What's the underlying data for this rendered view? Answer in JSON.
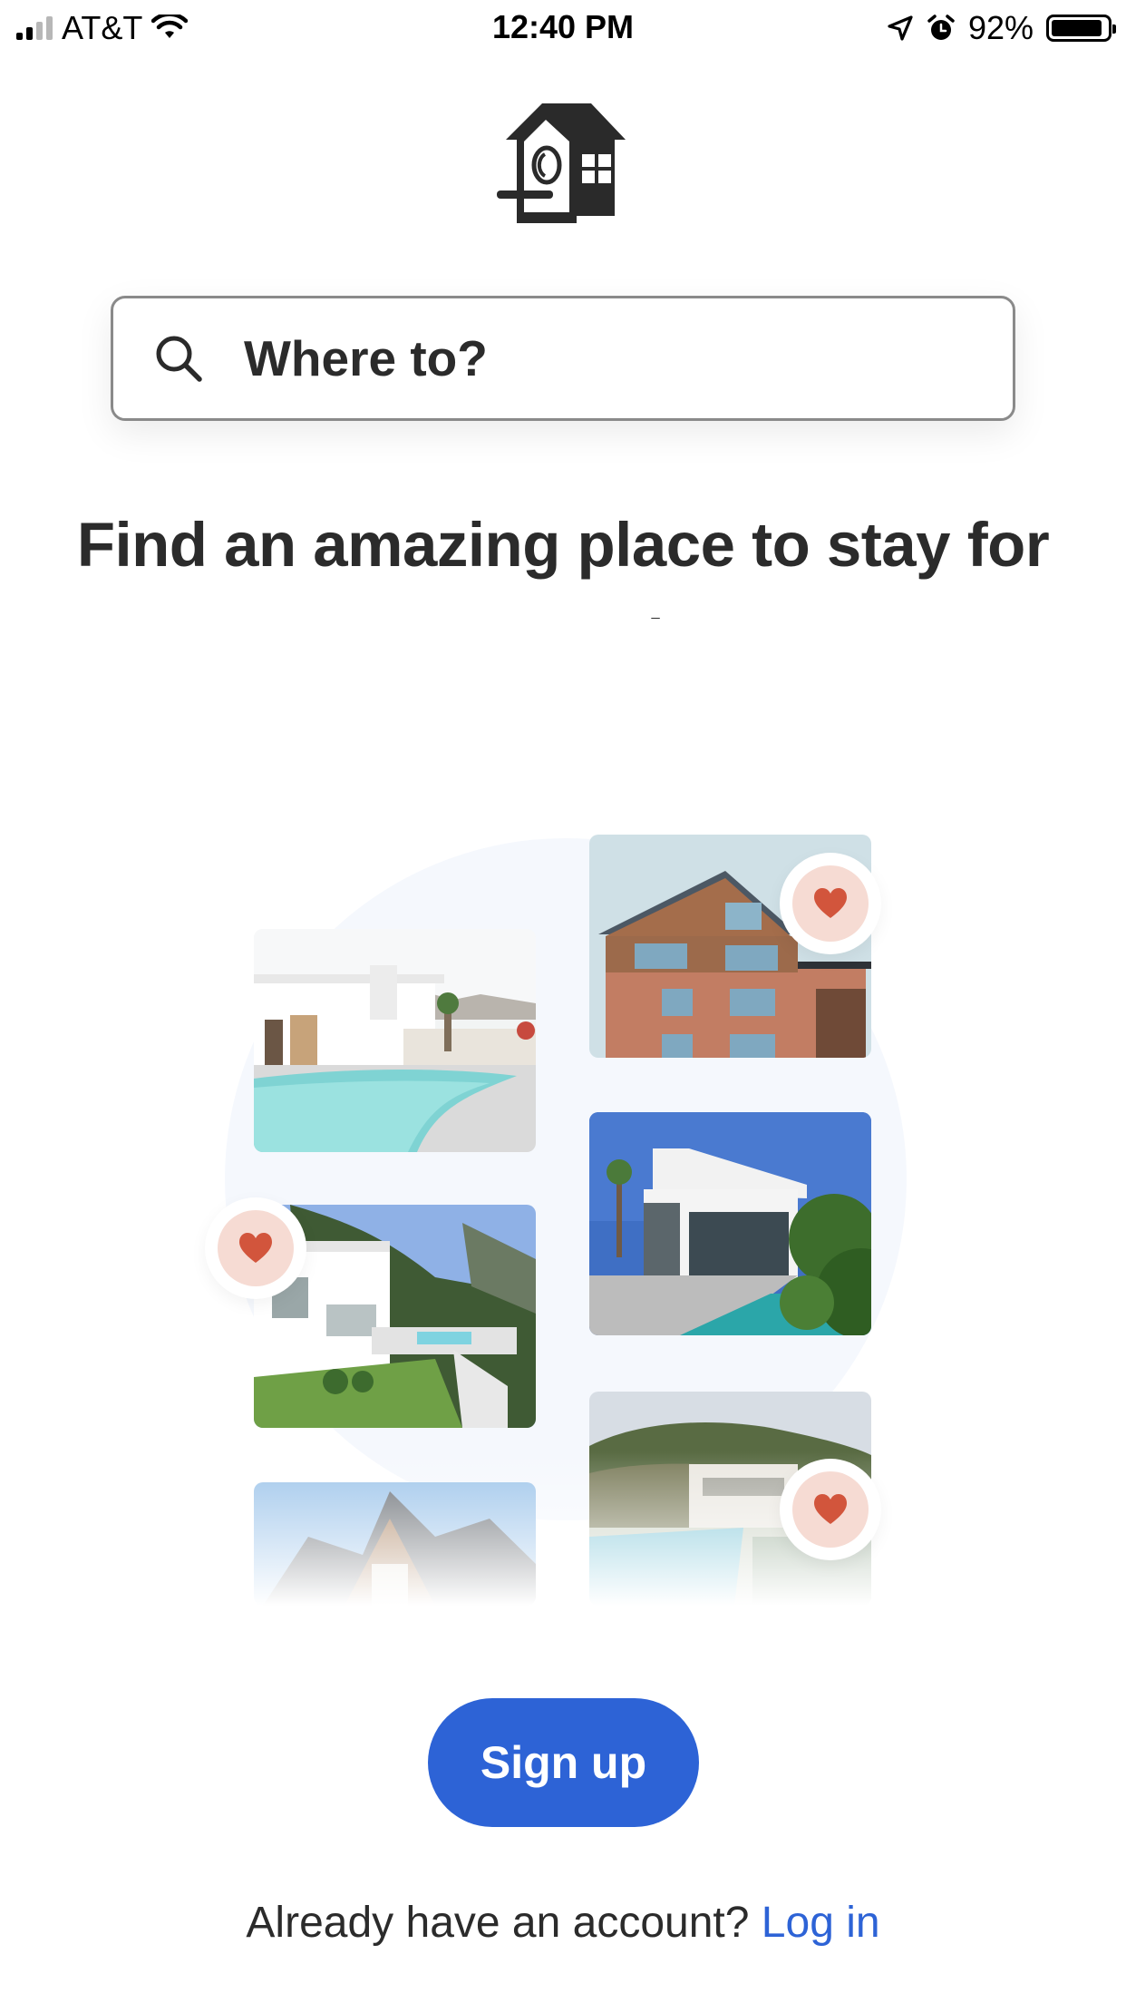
{
  "status_bar": {
    "carrier": "AT&T",
    "time": "12:40 PM",
    "battery_percent": "92%",
    "icons": [
      "signal-icon",
      "wifi-icon",
      "location-arrow-icon",
      "alarm-icon",
      "battery-icon"
    ]
  },
  "logo": {
    "icon": "house-logo-icon"
  },
  "search": {
    "placeholder": "Where to?",
    "icon": "search-icon"
  },
  "headline": {
    "text": "Find an amazing place to stay for every trip"
  },
  "collage": {
    "photos": [
      "pool-villa-photo",
      "wood-brick-house-photo",
      "cliffside-villa-photo",
      "modern-villa-photo",
      "gabled-house-photo",
      "hillside-pool-house-photo"
    ],
    "favorite_icon": "heart-icon"
  },
  "actions": {
    "signup_label": "Sign up",
    "login_prompt": "Already have an account?",
    "login_link": "Log in"
  },
  "colors": {
    "accent": "#2d63d6",
    "text": "#2b2b2b",
    "heart": "#d2553c",
    "heart_bg": "#f6dbd3"
  }
}
